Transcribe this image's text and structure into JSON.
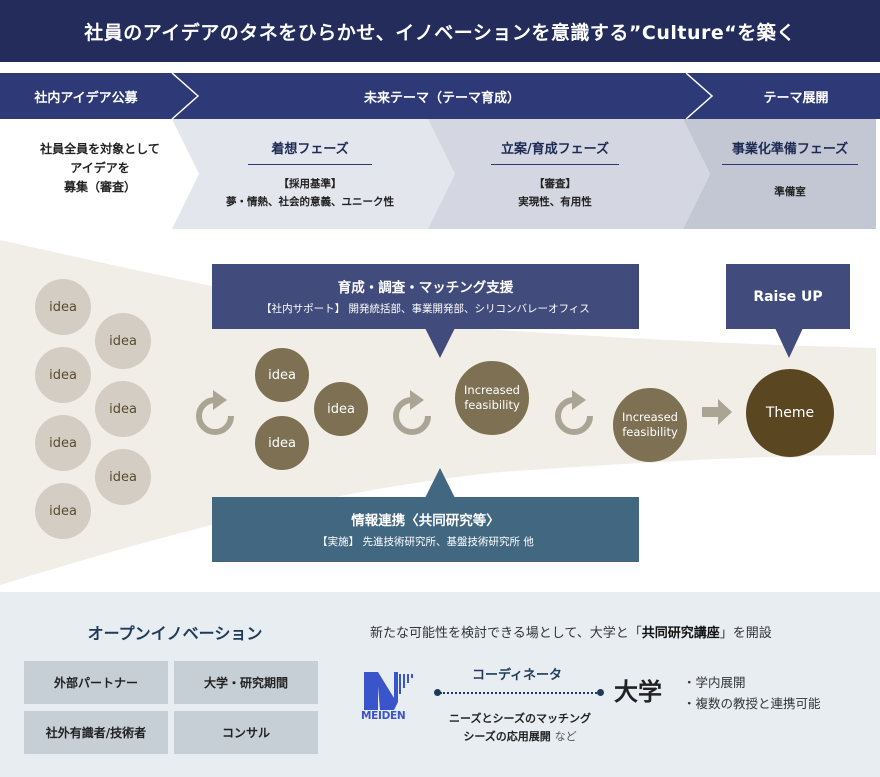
{
  "header": {
    "title": "社員のアイデアのタネをひらかせ、イノベーションを意識する”Culture“を築く"
  },
  "phases": {
    "stage1": {
      "label": "社内アイデア公募",
      "description_lines": [
        "社員全員を対象として",
        "アイデアを",
        "募集（審査）"
      ]
    },
    "stage2": {
      "label": "未来テーマ（テーマ育成）"
    },
    "stage3": {
      "label": "テーマ展開"
    },
    "sub_phases": [
      {
        "title": "着想フェーズ",
        "details": [
          "【採用基準】",
          "夢・情熱、社会的意義、ユニーク性"
        ]
      },
      {
        "title": "立案/育成フェーズ",
        "details": [
          "【審査】",
          "実現性、有用性"
        ]
      },
      {
        "title": "事業化準備フェーズ",
        "details": [
          "準備室"
        ]
      }
    ]
  },
  "funnel": {
    "initial_ideas": [
      "idea",
      "idea",
      "idea",
      "idea",
      "idea",
      "idea",
      "idea"
    ],
    "selected_ideas": [
      "idea",
      "idea",
      "idea"
    ],
    "feasibility_1": [
      "Increased",
      "feasibility"
    ],
    "feasibility_2": [
      "Increased",
      "feasibility"
    ],
    "theme": "Theme",
    "icons": [
      "refresh-icon",
      "refresh-icon",
      "refresh-icon",
      "right-arrow-icon"
    ]
  },
  "callouts": {
    "support": {
      "title": "育成・調査・マッチング支援",
      "subtitle": "【社内サポート】 開発統括部、事業開発部、シリコンバレーオフィス"
    },
    "info": {
      "title": "情報連携〈共同研究等〉",
      "subtitle": "【実施】 先進技術研究所、基盤技術研究所 他"
    },
    "raise": {
      "label": "Raise UP"
    }
  },
  "colors": {
    "navy": "#232c5b",
    "phase_bar": "#2e3a78",
    "callout_blue": "#414c7c",
    "callout_teal": "#416781",
    "idea_light": "#d3cdc3",
    "idea_mid": "#7d7053",
    "theme": "#5a4722",
    "funnel_bg": "#f1eee8",
    "bottom_bg": "#e7edf1",
    "meiden_blue": "#3a55c9"
  },
  "open_innovation": {
    "title": "オープンイノベーション",
    "partners": [
      "外部パートナー",
      "大学・研究期間",
      "社外有識者/技術者",
      "コンサル"
    ]
  },
  "university": {
    "lead_prefix": "新たな可能性を検討できる場として、大学と「",
    "lead_bold": "共同研究講座",
    "lead_suffix": "」を開設",
    "logo_text": "MEIDEN",
    "coordinator": "コーディネータ",
    "matching_line1": "ニーズとシーズのマッチング",
    "matching_line2": "シーズの応用展開",
    "matching_suffix": "など",
    "university_label": "大学",
    "bullets": [
      "・学内展開",
      "・複数の教授と連携可能"
    ]
  }
}
